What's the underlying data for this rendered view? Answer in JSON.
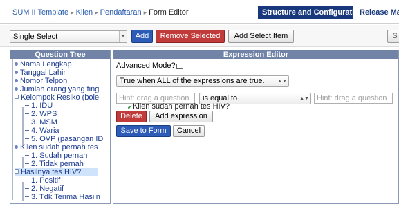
{
  "breadcrumb": {
    "items": [
      "SUM II Template",
      "Klien",
      "Pendaftaran"
    ],
    "current": "Form Editor"
  },
  "nav": {
    "structure": "Structure and Configuration",
    "release": "Release Ma"
  },
  "toolbar": {
    "select_value": "Single Select",
    "add_label": "Add",
    "remove_label": "Remove Selected",
    "add_item_label": "Add Select Item",
    "save_partial": "S"
  },
  "question_tree": {
    "title": "Question Tree",
    "items": [
      "Nama Lengkap",
      "Tanggal Lahir",
      "Nomor Telpon",
      "Jumlah orang yang ting",
      "Kelompok Resiko (bole",
      "1. IDU",
      "2. WPS",
      "3. MSM",
      "4. Waria",
      "5. OVP (pasangan ID",
      "Klien sudah pernah tes",
      "1. Sudah pernah",
      "2. Tidak pernah",
      "Hasilnya tes HIV?",
      "1. Positif",
      "2. Negatif",
      "3. Tdk Terima Hasiln"
    ]
  },
  "expression_editor": {
    "title": "Expression Editor",
    "advanced_mode_label": "Advanced Mode?",
    "mode_select": "True when ALL of the expressions are true.",
    "hint_left": "Hint: drag a question",
    "operator": "is equal to",
    "hint_right": "Hint: drag a question",
    "dragged_item": "Klien sudah pernah tes HIV?",
    "delete_label": "Delete",
    "add_expression_label": "Add expression",
    "save_label": "Save to Form",
    "cancel_label": "Cancel"
  },
  "colors": {
    "primary_blue": "#2d5cb8",
    "nav_dark_blue": "#17387c",
    "danger_red": "#c13b3b",
    "panel_header": "#7184a8",
    "tree_selected_bg": "#cfe3fb",
    "link_blue": "#2a5db0"
  },
  "icons": [
    "chevron-right-icon",
    "select-arrow-icon",
    "tree-node-icon",
    "tree-collapse-icon",
    "checkmark-icon",
    "up-down-arrows-icon"
  ]
}
